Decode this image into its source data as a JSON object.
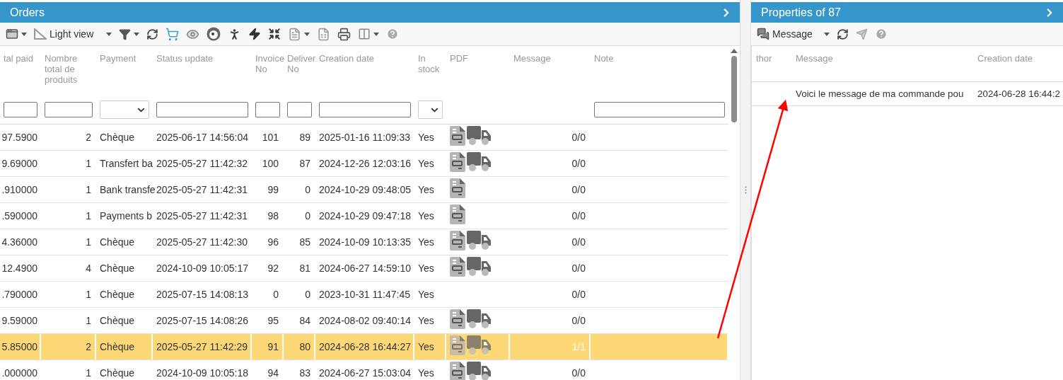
{
  "orders_panel": {
    "title": "Orders",
    "toolbar": {
      "view_label": "Light view"
    },
    "columns": [
      {
        "label": "tal paid",
        "kind": "number"
      },
      {
        "label": "Nombre total de produits",
        "kind": "number"
      },
      {
        "label": "Payment",
        "kind": "text"
      },
      {
        "label": "Status update",
        "kind": "text"
      },
      {
        "label": "Invoice No",
        "kind": "number"
      },
      {
        "label": "Deliver No",
        "kind": "number"
      },
      {
        "label": "Creation date",
        "kind": "text"
      },
      {
        "label": "In stock",
        "kind": "text"
      },
      {
        "label": "PDF",
        "kind": "docs"
      },
      {
        "label": "Message",
        "kind": "count"
      },
      {
        "label": "Note",
        "kind": "text"
      }
    ],
    "filters": [
      {
        "kind": "text"
      },
      {
        "kind": "text"
      },
      {
        "kind": "select"
      },
      {
        "kind": "text"
      },
      {
        "kind": "text"
      },
      {
        "kind": "text"
      },
      {
        "kind": "text"
      },
      {
        "kind": "select"
      },
      {
        "kind": "none"
      },
      {
        "kind": "none"
      },
      {
        "kind": "text"
      }
    ],
    "rows": [
      {
        "selected": false,
        "invoice_doc": true,
        "delivery_doc": true,
        "cells": [
          "97.5900",
          "2",
          "Chèque",
          "2025-06-17 14:56:04",
          "101",
          "89",
          "2025-01-16 11:09:33",
          "Yes",
          "",
          "0/0",
          ""
        ]
      },
      {
        "selected": false,
        "invoice_doc": true,
        "delivery_doc": true,
        "cells": [
          "9.69000",
          "1",
          "Transfert ba",
          "2025-05-27 11:42:32",
          "100",
          "87",
          "2024-12-26 12:03:16",
          "Yes",
          "",
          "0/0",
          ""
        ]
      },
      {
        "selected": false,
        "invoice_doc": true,
        "delivery_doc": false,
        "cells": [
          ".910000",
          "1",
          "Bank transfe",
          "2025-05-27 11:42:31",
          "99",
          "0",
          "2024-10-29 09:48:05",
          "Yes",
          "",
          "0/0",
          ""
        ]
      },
      {
        "selected": false,
        "invoice_doc": true,
        "delivery_doc": false,
        "cells": [
          ".590000",
          "1",
          "Payments b",
          "2025-05-27 11:42:31",
          "98",
          "0",
          "2024-10-29 09:47:18",
          "Yes",
          "",
          "0/0",
          ""
        ]
      },
      {
        "selected": false,
        "invoice_doc": true,
        "delivery_doc": true,
        "cells": [
          "4.36000",
          "1",
          "Chèque",
          "2025-05-27 11:42:30",
          "96",
          "85",
          "2024-10-09 10:13:35",
          "Yes",
          "",
          "0/0",
          ""
        ]
      },
      {
        "selected": false,
        "invoice_doc": true,
        "delivery_doc": true,
        "cells": [
          "12.4900",
          "4",
          "Chèque",
          "2024-10-09 10:05:17",
          "92",
          "81",
          "2024-06-27 14:59:10",
          "Yes",
          "",
          "0/0",
          ""
        ]
      },
      {
        "selected": false,
        "invoice_doc": false,
        "delivery_doc": false,
        "cells": [
          ".790000",
          "1",
          "Chèque",
          "2025-07-15 14:08:13",
          "0",
          "0",
          "2023-10-31 11:47:45",
          "Yes",
          "",
          "0/0",
          ""
        ]
      },
      {
        "selected": false,
        "invoice_doc": true,
        "delivery_doc": true,
        "cells": [
          "9.59000",
          "1",
          "Chèque",
          "2025-07-15 14:08:26",
          "95",
          "84",
          "2024-08-02 09:40:14",
          "Yes",
          "",
          "0/0",
          ""
        ]
      },
      {
        "selected": true,
        "invoice_doc": true,
        "delivery_doc": true,
        "cells": [
          "5.85000",
          "2",
          "Chèque",
          "2025-05-27 11:42:29",
          "91",
          "80",
          "2024-06-28 16:44:27",
          "Yes",
          "",
          "1/1",
          ""
        ]
      },
      {
        "selected": false,
        "invoice_doc": true,
        "delivery_doc": true,
        "cells": [
          ".000000",
          "1",
          "Chèque",
          "2024-10-09 10:05:18",
          "94",
          "83",
          "2024-06-27 15:03:04",
          "Yes",
          "",
          "0/0",
          ""
        ]
      }
    ]
  },
  "properties_panel": {
    "title": "Properties of 87",
    "toolbar": {
      "view_label": "Message"
    },
    "columns": [
      "thor",
      "Message",
      "Creation date"
    ],
    "rows": [
      {
        "cells": [
          "",
          "Voici le message de ma commande pou",
          "2024-06-28 16:44:2"
        ]
      }
    ]
  }
}
